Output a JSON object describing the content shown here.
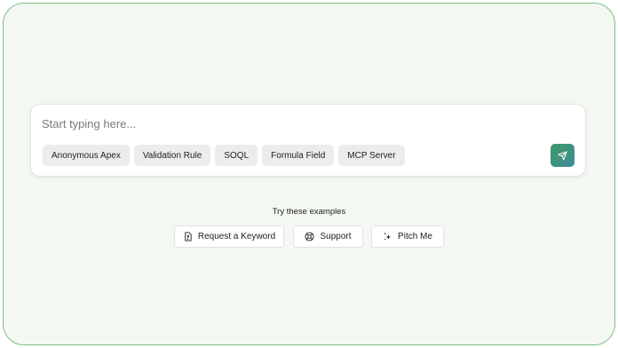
{
  "prompt": {
    "placeholder": "Start typing here...",
    "chips": [
      "Anonymous Apex",
      "Validation Rule",
      "SOQL",
      "Formula Field",
      "MCP Server"
    ],
    "send_icon": "send-icon"
  },
  "examples": {
    "heading": "Try these examples",
    "items": [
      {
        "label": "Request a Keyword",
        "icon": "document-question-icon"
      },
      {
        "label": "Support",
        "icon": "lifebuoy-icon"
      },
      {
        "label": "Pitch Me",
        "icon": "sparkle-icon"
      }
    ]
  },
  "colors": {
    "frame_border": "#7fbf7f",
    "background": "#f4f8f2",
    "send_gradient_start": "#3f9a68",
    "send_gradient_end": "#3c8d96"
  }
}
